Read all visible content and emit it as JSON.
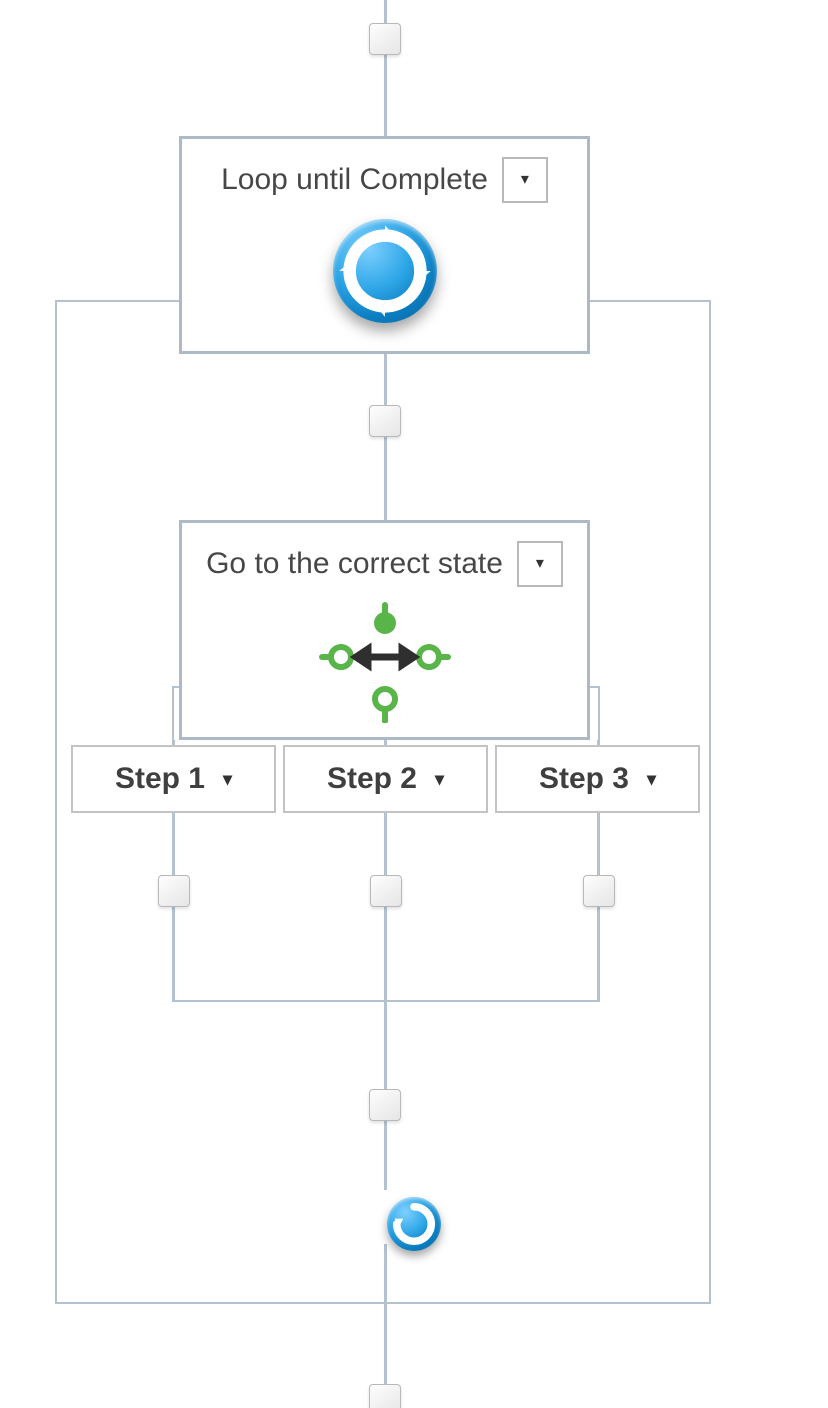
{
  "loop_node": {
    "title": "Loop until Complete",
    "icon": "cycle-icon"
  },
  "state_machine_node": {
    "title": "Go to the correct state",
    "icon": "state-machine-icon",
    "branches": [
      {
        "label": "Step 1"
      },
      {
        "label": "Step 2"
      },
      {
        "label": "Step 3"
      }
    ]
  }
}
